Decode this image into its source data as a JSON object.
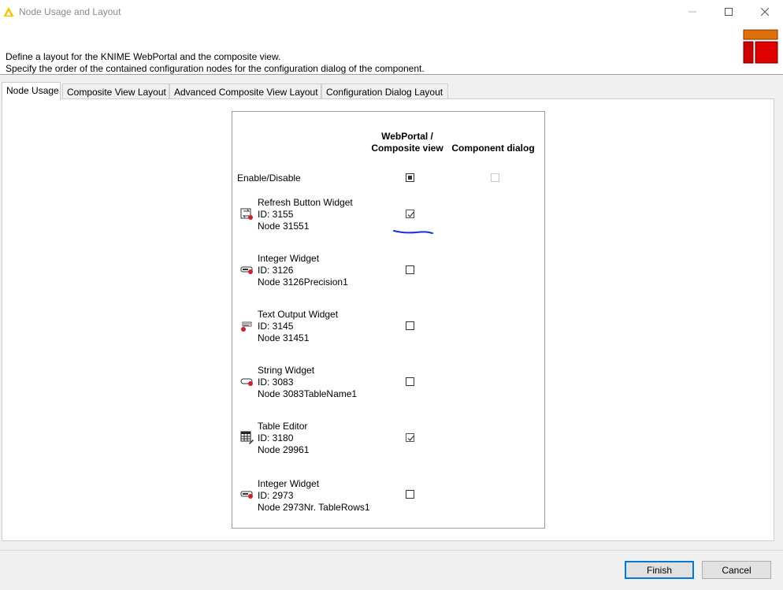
{
  "window": {
    "title": "Node Usage and Layout",
    "accent_color": "#0078d7"
  },
  "header": {
    "line1": "Define a layout for the KNIME WebPortal and the composite view.",
    "line2": "Specify the order of the contained configuration nodes for the configuration dialog of the component.",
    "logo_colors": [
      "#e0700a",
      "#cc0000"
    ]
  },
  "tabs": [
    {
      "label": "Node Usage",
      "active": true
    },
    {
      "label": "Composite View Layout",
      "active": false
    },
    {
      "label": "Advanced Composite View Layout",
      "active": false
    },
    {
      "label": "Configuration Dialog Layout",
      "active": false
    }
  ],
  "table": {
    "col_webportal_line1": "WebPortal /",
    "col_webportal_line2": "Composite view",
    "col_component": "Component dialog",
    "enable_label": "Enable/Disable",
    "rows": [
      {
        "icon": "refresh-widget-icon",
        "name": "Refresh Button Widget",
        "id": "ID: 3155",
        "node": "Node 31551",
        "webportal_checked": true
      },
      {
        "icon": "integer-widget-icon",
        "name": "Integer Widget",
        "id": "ID: 3126",
        "node": "Node 3126Precision1",
        "webportal_checked": false
      },
      {
        "icon": "text-output-widget-icon",
        "name": "Text Output Widget",
        "id": "ID: 3145",
        "node": "Node 31451",
        "webportal_checked": false
      },
      {
        "icon": "string-widget-icon",
        "name": "String Widget",
        "id": "ID: 3083",
        "node": "Node 3083TableName1",
        "webportal_checked": false
      },
      {
        "icon": "table-editor-icon",
        "name": "Table Editor",
        "id": "ID: 3180",
        "node": "Node 29961",
        "webportal_checked": true
      },
      {
        "icon": "integer-widget-icon",
        "name": "Integer Widget",
        "id": "ID: 2973",
        "node": "Node 2973Nr. TableRows1",
        "webportal_checked": false
      }
    ]
  },
  "buttons": {
    "finish": "Finish",
    "cancel": "Cancel"
  },
  "annotation": {
    "color": "#1a2fd6"
  }
}
